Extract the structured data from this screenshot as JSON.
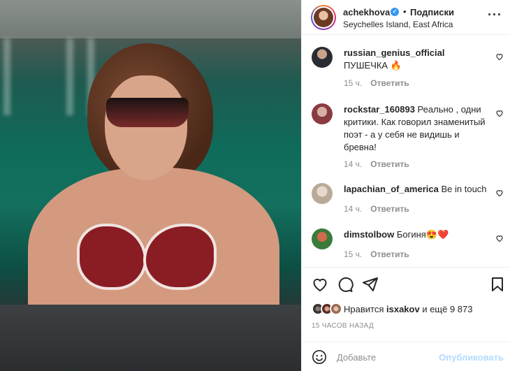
{
  "post": {
    "username": "achekhova",
    "follow_label": "Подписки",
    "location": "Seychelles Island, East Africa"
  },
  "comments": [
    {
      "username": "russian_genius_official",
      "text": "ПУШЕЧКА 🔥",
      "time": "15 ч.",
      "reply": "Ответить"
    },
    {
      "username": "rockstar_160893",
      "text": "Реально , одни критики. Как говорил знаменитый поэт - а у себя не видишь и бревна!",
      "time": "14 ч.",
      "reply": "Ответить"
    },
    {
      "username": "lapachian_of_america",
      "text": "Be in touch",
      "time": "14 ч.",
      "reply": "Ответить"
    },
    {
      "username": "dimstolbow",
      "text": "Богиня😍❤️",
      "time": "15 ч.",
      "reply": "Ответить"
    }
  ],
  "likes": {
    "prefix": "Нравится",
    "user": "isxakov",
    "suffix": "и ещё 9 873"
  },
  "time_ago": "15 ЧАСОВ НАЗАД",
  "add_comment": {
    "placeholder": "Добавьте",
    "publish_label": "Опубликовать"
  },
  "colors": {
    "verified": "#3897f0",
    "publish_disabled": "#b3dbff"
  }
}
